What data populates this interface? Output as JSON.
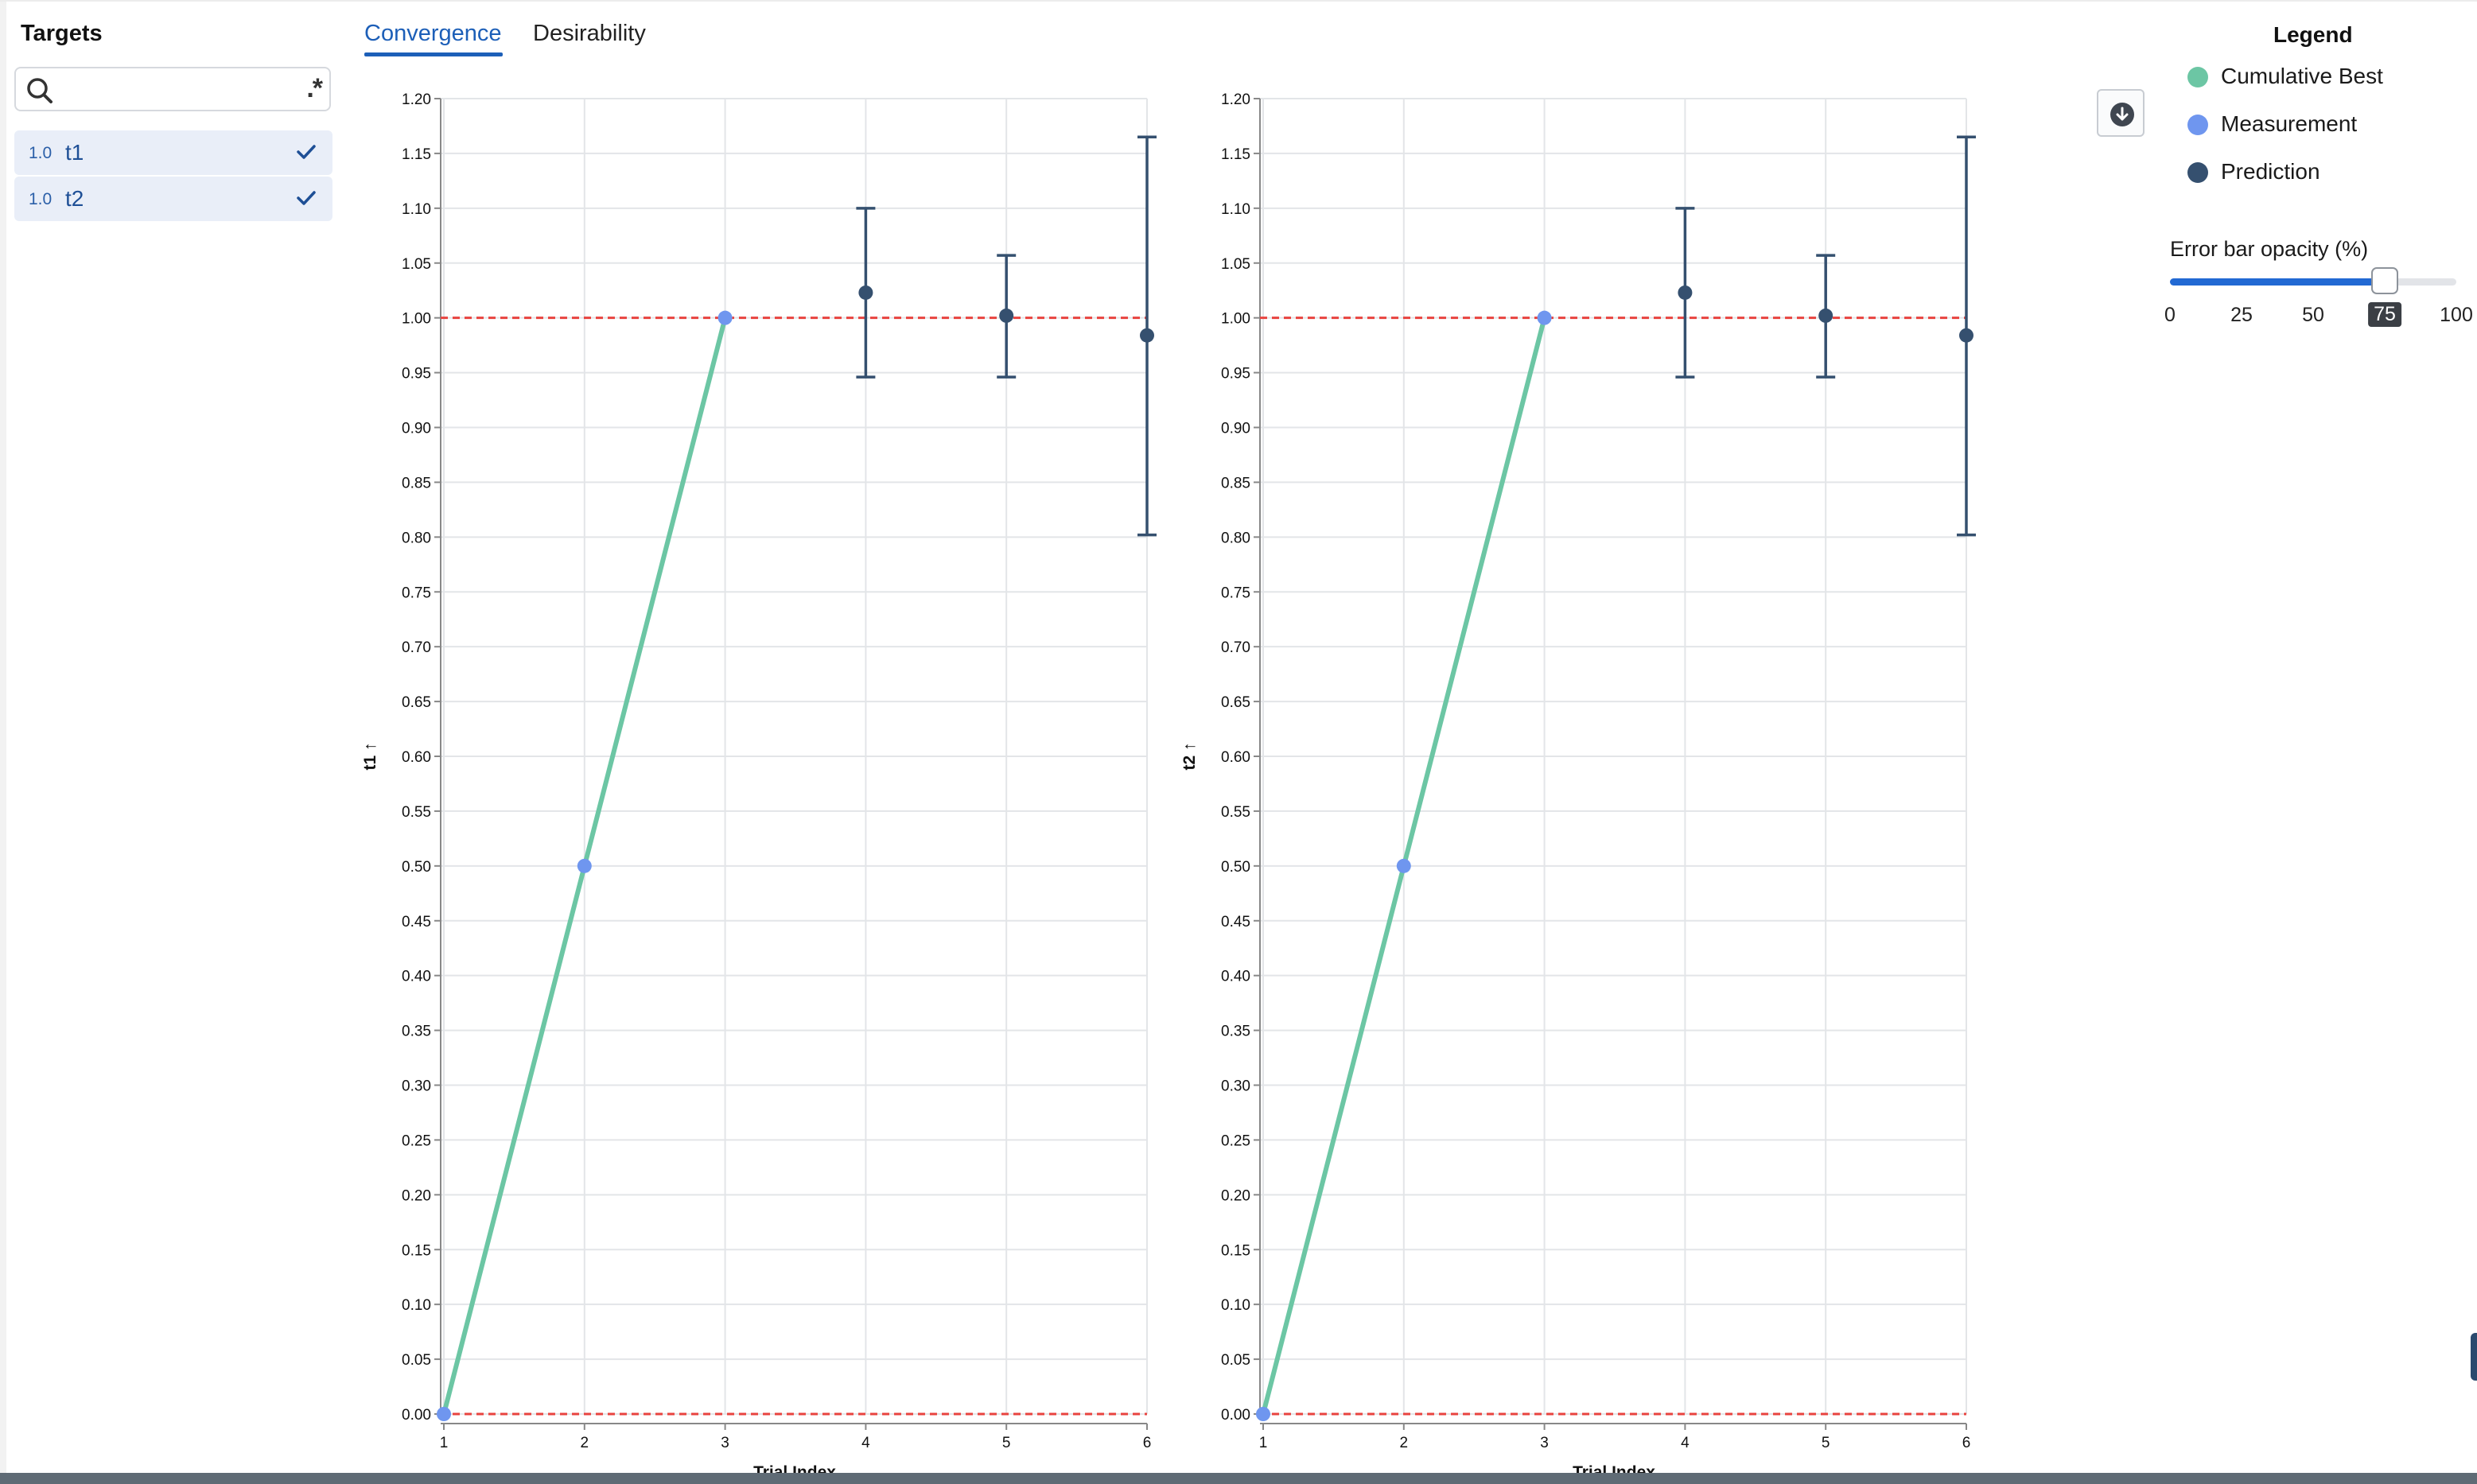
{
  "sidebar": {
    "title": "Targets",
    "search": {
      "value": "",
      "placeholder": "",
      "regex_symbol": ".*"
    },
    "targets": [
      {
        "weight": "1.0",
        "label": "t1",
        "selected": true
      },
      {
        "weight": "1.0",
        "label": "t2",
        "selected": true
      }
    ]
  },
  "tabs": [
    {
      "label": "Convergence",
      "active": true
    },
    {
      "label": "Desirability",
      "active": false
    }
  ],
  "legend": {
    "title": "Legend",
    "items": [
      {
        "label": "Cumulative Best",
        "color": "#6cc6a4"
      },
      {
        "label": "Measurement",
        "color": "#6f96ef"
      },
      {
        "label": "Prediction",
        "color": "#35506f"
      }
    ]
  },
  "slider": {
    "label": "Error bar opacity (%)",
    "value": 75,
    "min": 0,
    "max": 100,
    "marks": [
      "0",
      "25",
      "50",
      "75",
      "100"
    ]
  },
  "colors": {
    "accent": "#1d5fb8",
    "cumulative_best": "#6cc6a4",
    "measurement": "#6f96ef",
    "prediction": "#35506f",
    "reference_line": "#e8433f"
  },
  "chart_data": [
    {
      "type": "line",
      "xlabel": "Trial Index",
      "ylabel": "t1 ↑",
      "xlim": [
        1,
        6
      ],
      "ylim": [
        0,
        1.2
      ],
      "x_ticks": [
        "1",
        "2",
        "3",
        "4",
        "5",
        "6"
      ],
      "y_ticks": [
        "0.00",
        "0.05",
        "0.10",
        "0.15",
        "0.20",
        "0.25",
        "0.30",
        "0.35",
        "0.40",
        "0.45",
        "0.50",
        "0.55",
        "0.60",
        "0.65",
        "0.70",
        "0.75",
        "0.80",
        "0.85",
        "0.90",
        "0.95",
        "1.00",
        "1.05",
        "1.10",
        "1.15",
        "1.20"
      ],
      "grid": true,
      "reference_lines": [
        0.0,
        1.0
      ],
      "series": [
        {
          "name": "Cumulative Best",
          "x": [
            1,
            2,
            3
          ],
          "y": [
            0.0,
            0.5,
            1.0
          ]
        },
        {
          "name": "Measurement",
          "x": [
            1,
            2,
            3
          ],
          "y": [
            0.0,
            0.5,
            1.0
          ]
        },
        {
          "name": "Prediction",
          "x": [
            4,
            5,
            6
          ],
          "y": [
            1.023,
            1.002,
            0.984
          ],
          "lower": [
            0.946,
            0.946,
            0.802
          ],
          "upper": [
            1.1,
            1.057,
            1.165
          ]
        }
      ]
    },
    {
      "type": "line",
      "xlabel": "Trial Index",
      "ylabel": "t2 ↑",
      "xlim": [
        1,
        6
      ],
      "ylim": [
        0,
        1.2
      ],
      "x_ticks": [
        "1",
        "2",
        "3",
        "4",
        "5",
        "6"
      ],
      "y_ticks": [
        "0.00",
        "0.05",
        "0.10",
        "0.15",
        "0.20",
        "0.25",
        "0.30",
        "0.35",
        "0.40",
        "0.45",
        "0.50",
        "0.55",
        "0.60",
        "0.65",
        "0.70",
        "0.75",
        "0.80",
        "0.85",
        "0.90",
        "0.95",
        "1.00",
        "1.05",
        "1.10",
        "1.15",
        "1.20"
      ],
      "grid": true,
      "reference_lines": [
        0.0,
        1.0
      ],
      "series": [
        {
          "name": "Cumulative Best",
          "x": [
            1,
            2,
            3
          ],
          "y": [
            0.0,
            0.5,
            1.0
          ]
        },
        {
          "name": "Measurement",
          "x": [
            1,
            2,
            3
          ],
          "y": [
            0.0,
            0.5,
            1.0
          ]
        },
        {
          "name": "Prediction",
          "x": [
            4,
            5,
            6
          ],
          "y": [
            1.023,
            1.002,
            0.984
          ],
          "lower": [
            0.946,
            0.946,
            0.802
          ],
          "upper": [
            1.1,
            1.057,
            1.165
          ]
        }
      ]
    }
  ]
}
